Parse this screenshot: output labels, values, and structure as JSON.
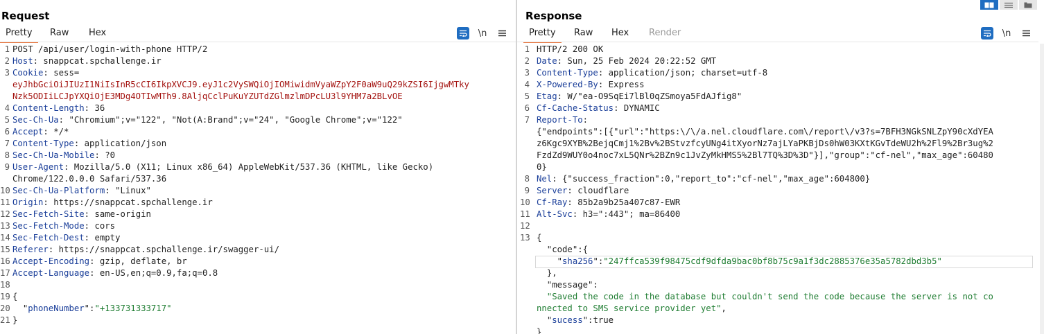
{
  "request": {
    "title": "Request",
    "tabs": [
      {
        "label": "Pretty",
        "active": true
      },
      {
        "label": "Raw",
        "active": false
      },
      {
        "label": "Hex",
        "active": false
      }
    ],
    "toolbar": {
      "wrap_icon": "word-wrap-icon",
      "newline_label": "\\n",
      "menu_icon": "hamburger-menu-icon"
    },
    "lines": [
      {
        "n": "1",
        "t": "POST /api/user/login-with-phone HTTP/2"
      },
      {
        "n": "2",
        "h": "Host",
        "v": " snappcat.spchallenge.ir"
      },
      {
        "n": "3",
        "h": "Cookie",
        "v": " sess="
      },
      {
        "n": "",
        "red": "eyJhbGciOiJIUzI1NiIsInR5cCI6IkpXVCJ9.eyJ1c2VySWQiOjIOMiwidmVyaWZpY2F0aW9uQ29kZSI6IjgwMTky"
      },
      {
        "n": "",
        "red": "Nzk5ODIiLCJpYXQiOjE3MDg4OTIwMTh9.8AljqCclPuKuYZUTdZGlmzlmDPcLU3l9YHM7a2BLvOE"
      },
      {
        "n": "4",
        "h": "Content-Length",
        "v": " 36"
      },
      {
        "n": "5",
        "h": "Sec-Ch-Ua",
        "v": " \"Chromium\";v=\"122\", \"Not(A:Brand\";v=\"24\", \"Google Chrome\";v=\"122\""
      },
      {
        "n": "6",
        "h": "Accept",
        "v": " */*"
      },
      {
        "n": "7",
        "h": "Content-Type",
        "v": " application/json"
      },
      {
        "n": "8",
        "h": "Sec-Ch-Ua-Mobile",
        "v": " ?0"
      },
      {
        "n": "9",
        "h": "User-Agent",
        "v": " Mozilla/5.0 (X11; Linux x86_64) AppleWebKit/537.36 (KHTML, like Gecko)"
      },
      {
        "n": "",
        "t": "Chrome/122.0.0.0 Safari/537.36"
      },
      {
        "n": "10",
        "h": "Sec-Ch-Ua-Platform",
        "v": " \"Linux\""
      },
      {
        "n": "11",
        "h": "Origin",
        "v": " https://snappcat.spchallenge.ir"
      },
      {
        "n": "12",
        "h": "Sec-Fetch-Site",
        "v": " same-origin"
      },
      {
        "n": "13",
        "h": "Sec-Fetch-Mode",
        "v": " cors"
      },
      {
        "n": "14",
        "h": "Sec-Fetch-Dest",
        "v": " empty"
      },
      {
        "n": "15",
        "h": "Referer",
        "v": " https://snappcat.spchallenge.ir/swagger-ui/"
      },
      {
        "n": "16",
        "h": "Accept-Encoding",
        "v": " gzip, deflate, br"
      },
      {
        "n": "17",
        "h": "Accept-Language",
        "v": " en-US,en;q=0.9,fa;q=0.8"
      },
      {
        "n": "18",
        "t": ""
      },
      {
        "n": "19",
        "t": "{"
      },
      {
        "n": "20",
        "jk": "phoneNumber",
        "jv": "+133731333717",
        "ind": "  "
      },
      {
        "n": "21",
        "t": "}"
      }
    ]
  },
  "response": {
    "title": "Response",
    "tabs": [
      {
        "label": "Pretty",
        "active": true
      },
      {
        "label": "Raw",
        "active": false
      },
      {
        "label": "Hex",
        "active": false
      },
      {
        "label": "Render",
        "active": false,
        "disabled": true
      }
    ],
    "toolbar": {
      "wrap_icon": "word-wrap-icon",
      "newline_label": "\\n",
      "menu_icon": "hamburger-menu-icon"
    },
    "layout_icons": [
      "side-by-side-layout-icon",
      "stacked-layout-icon",
      "tabbed-layout-icon"
    ],
    "lines": [
      {
        "n": "1",
        "t": "HTTP/2 200 OK"
      },
      {
        "n": "2",
        "h": "Date",
        "v": " Sun, 25 Feb 2024 20:22:52 GMT"
      },
      {
        "n": "3",
        "h": "Content-Type",
        "v": " application/json; charset=utf-8"
      },
      {
        "n": "4",
        "h": "X-Powered-By",
        "v": " Express"
      },
      {
        "n": "5",
        "h": "Etag",
        "v": " W/\"ea-O9SqEi7lBl0qZSmoya5FdAJfig8\""
      },
      {
        "n": "6",
        "h": "Cf-Cache-Status",
        "v": " DYNAMIC"
      },
      {
        "n": "7",
        "h": "Report-To",
        "v": ""
      },
      {
        "n": "",
        "t": "{\"endpoints\":[{\"url\":\"https:\\/\\/a.nel.cloudflare.com\\/report\\/v3?s=7BFH3NGkSNLZpY90cXdYEA"
      },
      {
        "n": "",
        "t": "z6Kgc9XYB%2BejqCmj1%2Bv%2BStvzfcyUNg4itXyorNz7ajLYaPKBjDs0hW03KXtKGvTdeWU2h%2Fl9%2Br3ug%2"
      },
      {
        "n": "",
        "t": "FzdZd9WUY0o4noc7xL5QNr%2BZn9c1JvZyMkHMS5%2Bl7TQ%3D%3D\"}],\"group\":\"cf-nel\",\"max_age\":60480"
      },
      {
        "n": "",
        "t": "0}"
      },
      {
        "n": "8",
        "h": "Nel",
        "v": " {\"success_fraction\":0,\"report_to\":\"cf-nel\",\"max_age\":604800}"
      },
      {
        "n": "9",
        "h": "Server",
        "v": " cloudflare"
      },
      {
        "n": "10",
        "h": "Cf-Ray",
        "v": " 85b2a9b25a407c87-EWR"
      },
      {
        "n": "11",
        "h": "Alt-Svc",
        "v": " h3=\":443\"; ma=86400"
      },
      {
        "n": "12",
        "t": ""
      },
      {
        "n": "13",
        "t": "{"
      },
      {
        "n": "",
        "t": "  \"code\":{",
        "jsonkey": "code"
      },
      {
        "n": "",
        "jk": "sha256",
        "jv": "247ffca539f98475cdf9dfda9bac0bf8b75c9a1f3dc2885376e35a5782dbd3b5",
        "ind": "    ",
        "highlight": true
      },
      {
        "n": "",
        "t": "  },"
      },
      {
        "n": "",
        "t": "  \"message\":",
        "jsonkey": "message"
      },
      {
        "n": "",
        "str": "  \"Saved the code in the database but couldn't send the code because the server is not co"
      },
      {
        "n": "",
        "str": "nnected to SMS service provider yet\"",
        "tail": ","
      },
      {
        "n": "",
        "jk": "sucess",
        "jlit": "true",
        "ind": "  "
      },
      {
        "n": "",
        "t": "}"
      }
    ]
  },
  "colors": {
    "accent": "#e8743b",
    "header_name": "#1a3e99",
    "json_string": "#1f7d32",
    "token_red": "#a3120f",
    "active_button": "#1f6dc1"
  }
}
